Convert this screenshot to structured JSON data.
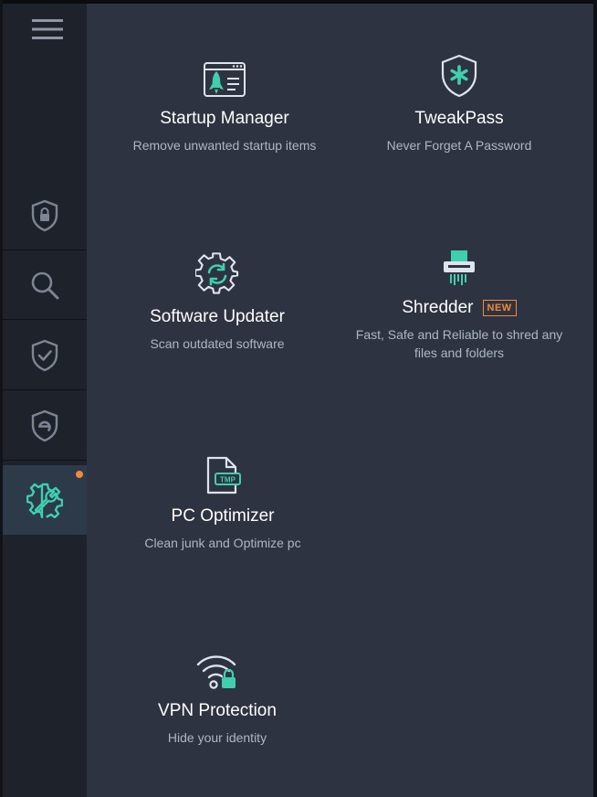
{
  "colors": {
    "accent": "#3fcfb0",
    "badge": "#f08a3a",
    "sidebar_bg": "#1e222a",
    "panel_bg": "#2d3340",
    "active_bg": "#2c3a4a",
    "muted_text": "#aeb6c6"
  },
  "sidebar": {
    "menu_icon": "hamburger-icon",
    "items": [
      {
        "icon": "shield-lock-icon",
        "active": false
      },
      {
        "icon": "search-icon",
        "active": false
      },
      {
        "icon": "shield-check-icon",
        "active": false
      },
      {
        "icon": "shield-e-icon",
        "active": false
      },
      {
        "icon": "gear-wrench-icon",
        "active": true,
        "notification": true
      }
    ]
  },
  "tools": [
    {
      "id": "startup-manager",
      "title": "Startup Manager",
      "desc": "Remove unwanted startup items",
      "icon": "rocket-window-icon"
    },
    {
      "id": "tweakpass",
      "title": "TweakPass",
      "desc": "Never Forget A Password",
      "icon": "shield-asterisk-icon"
    },
    {
      "id": "software-updater",
      "title": "Software Updater",
      "desc": "Scan outdated software",
      "icon": "gear-refresh-icon"
    },
    {
      "id": "shredder",
      "title": "Shredder",
      "badge": "NEW",
      "desc": "Fast, Safe and Reliable to shred any files and folders",
      "icon": "shredder-icon"
    },
    {
      "id": "pc-optimizer",
      "title": "PC Optimizer",
      "desc": "Clean junk and Optimize pc",
      "icon": "tmp-file-icon"
    },
    {
      "id": "vpn-protection",
      "title": "VPN Protection",
      "desc": "Hide your identity",
      "icon": "wifi-lock-icon"
    }
  ]
}
